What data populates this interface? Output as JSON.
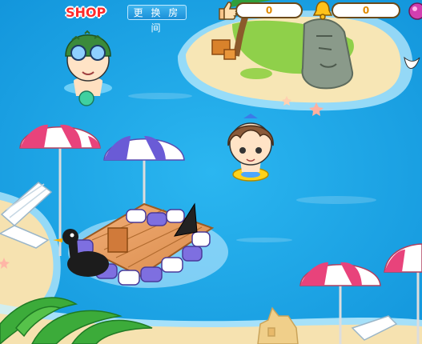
{
  "toolbar": {
    "shop_label": "SHOP",
    "change_room_label": "更 换 房 间",
    "likes_count": "0",
    "bells_count": "0"
  },
  "icons": {
    "likes": "thumbs-up-icon",
    "bells": "bell-icon",
    "gems": "gem-icon"
  },
  "colors": {
    "water": "#1aa3e6",
    "sand": "#f6e2b0",
    "shop_red": "#ff2a2a",
    "counter_text": "#e08a00"
  }
}
